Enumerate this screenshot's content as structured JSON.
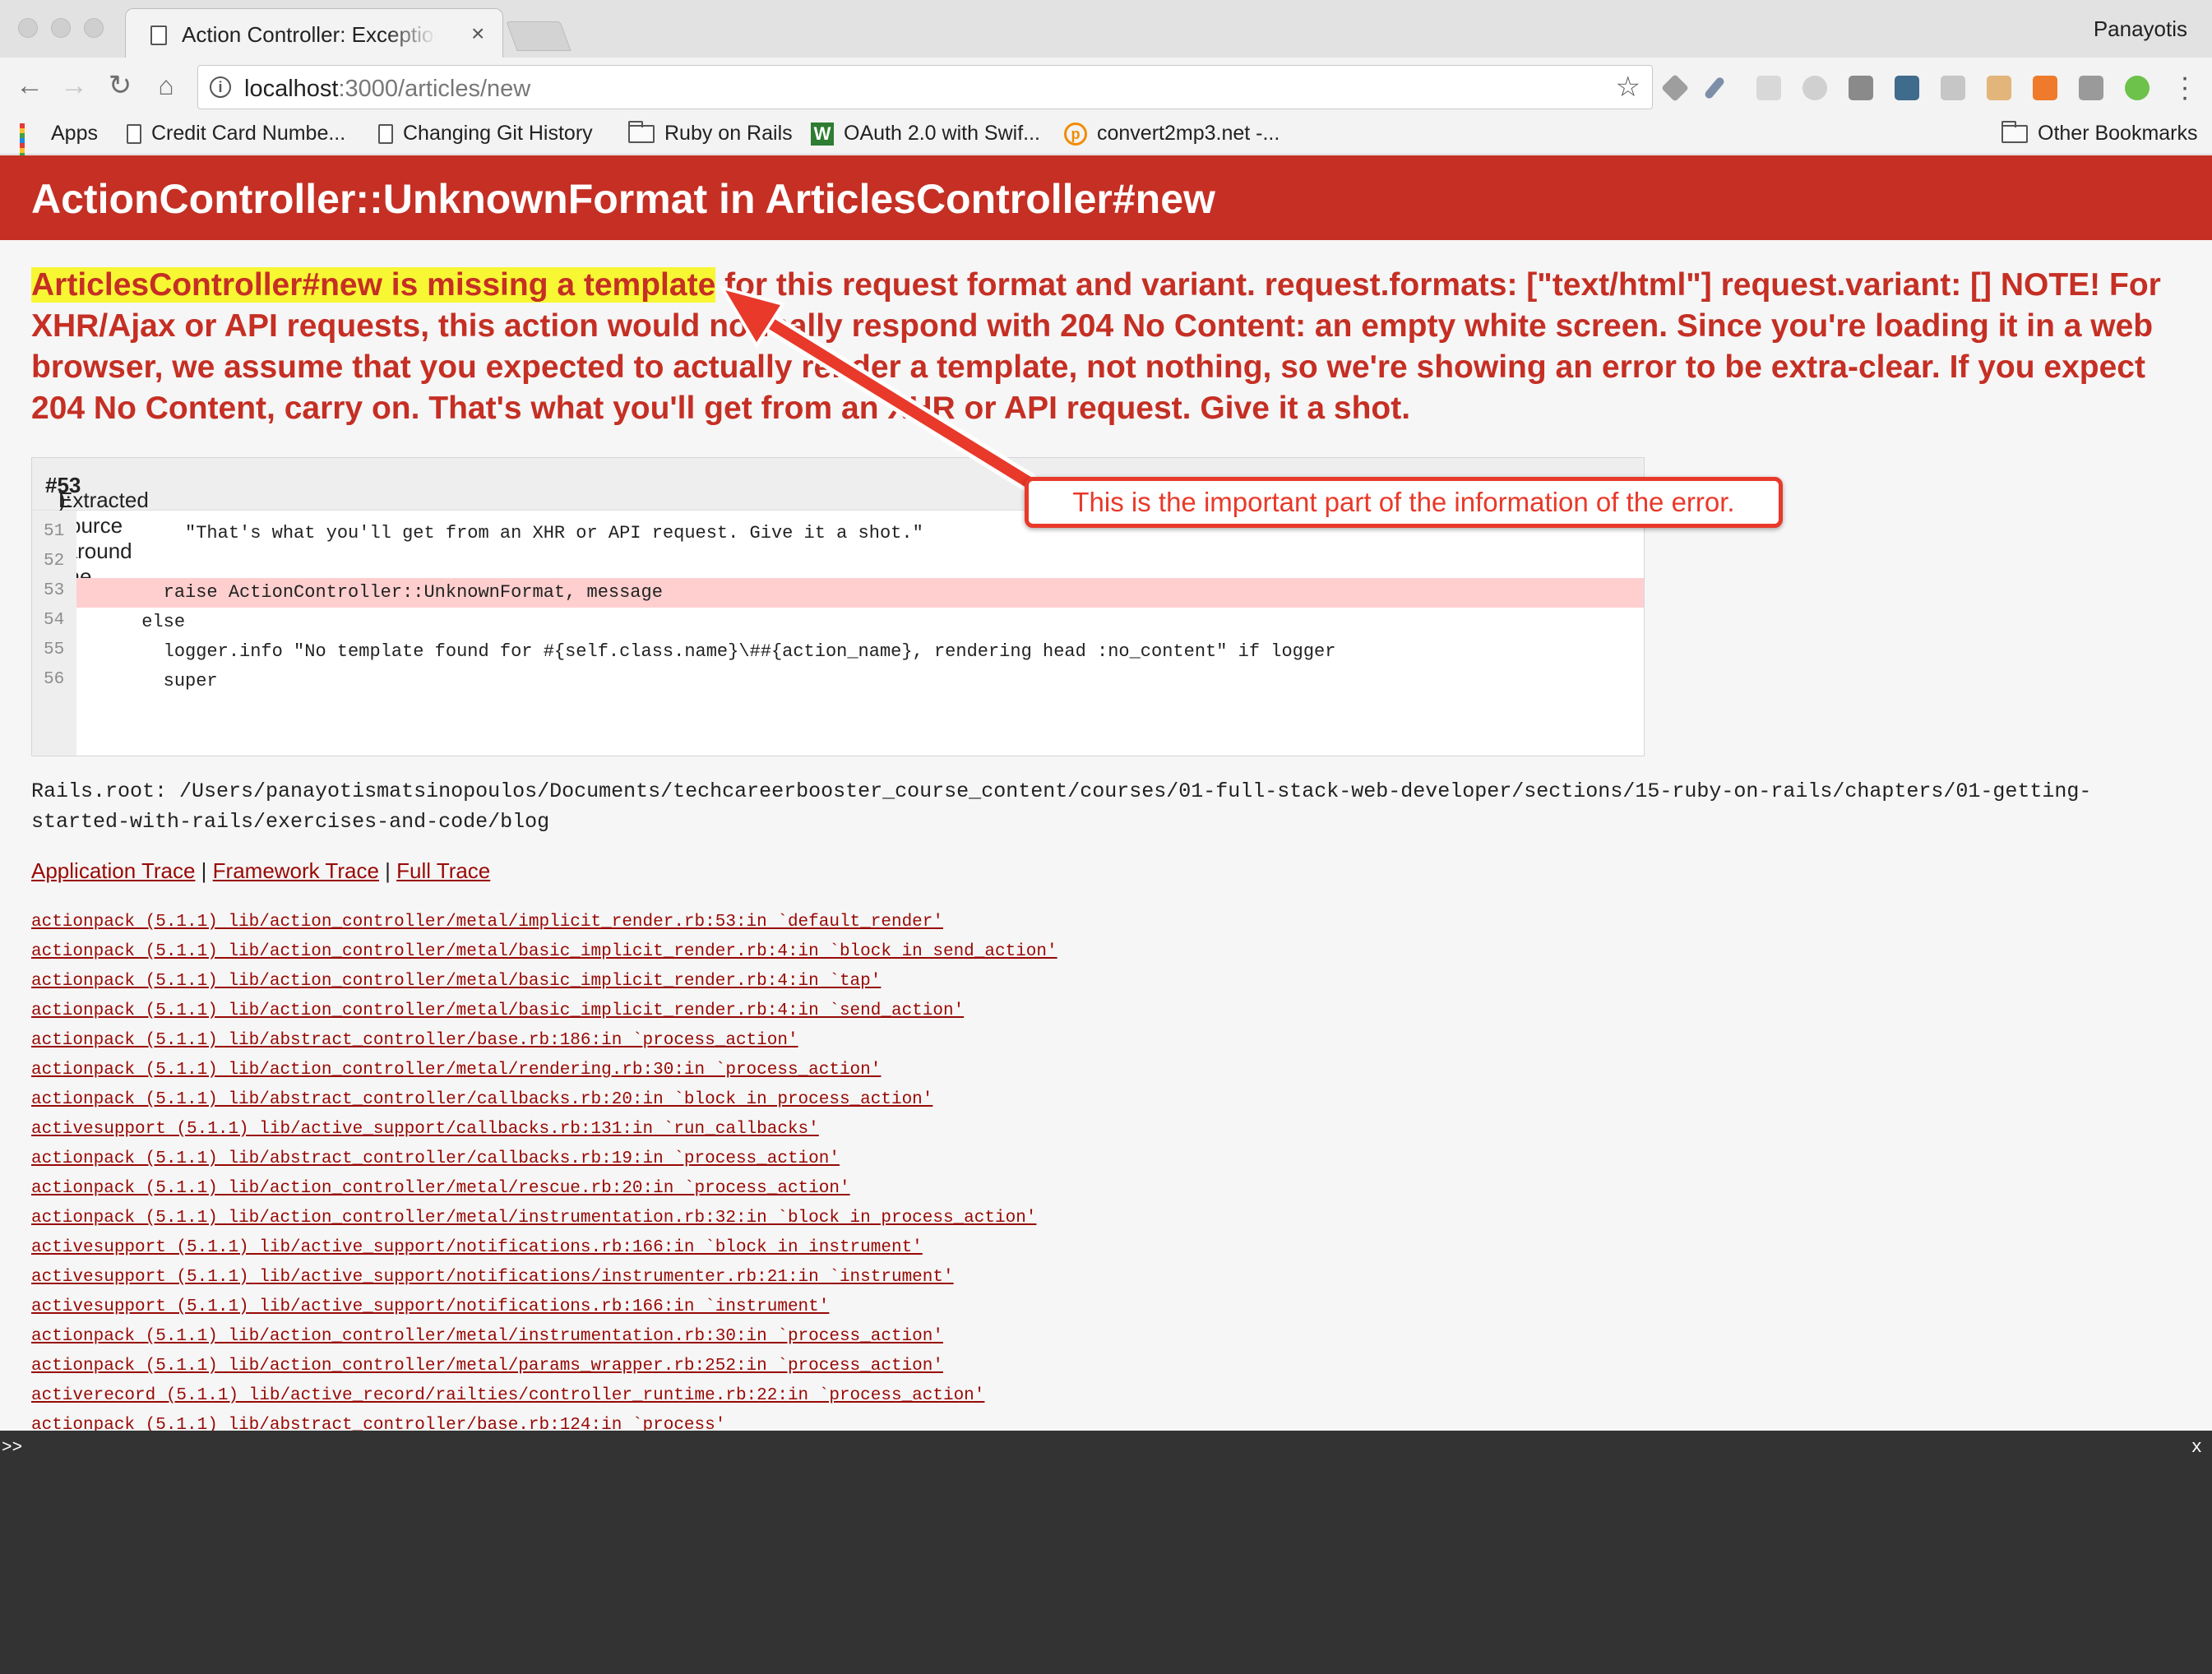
{
  "browser": {
    "tab_title": "Action Controller: Exception caught",
    "tab_close": "×",
    "profile_name": "Panayotis",
    "url_host": "localhost",
    "url_path": ":3000/articles/new",
    "bookmarks": [
      {
        "label": "Apps",
        "icon": "apps-grid-icon"
      },
      {
        "label": "Credit Card Numbe...",
        "icon": "document-icon"
      },
      {
        "label": "Changing Git History",
        "icon": "document-icon"
      },
      {
        "label": "Ruby on Rails",
        "icon": "folder-icon"
      },
      {
        "label": "OAuth 2.0 with Swif...",
        "icon": "w-logo-icon"
      },
      {
        "label": "convert2mp3.net -...",
        "icon": "convert2mp3-icon"
      }
    ],
    "other_bookmarks": "Other Bookmarks"
  },
  "page": {
    "title": "ActionController::UnknownFormat in ArticlesController#new",
    "message_highlight": "ArticlesController#new is missing a template",
    "message_rest": " for this request format and variant. request.formats: [\"text/html\"] request.variant: [] NOTE! For XHR/Ajax or API requests, this action would normally respond with 204 No Content: an empty white screen. Since you're loading it in a web browser, we assume that you expected to actually render a template, not nothing, so we're showing an error to be extra-clear. If you expect 204 No Content, carry on. That's what you'll get from an XHR or API request. Give it a shot.",
    "source_header_prefix": "Extracted source (around line ",
    "source_header_line": "#53",
    "source_header_suffix": "):",
    "source_lines": [
      {
        "no": "51",
        "code": "          \"That's what you'll get from an XHR or API request. Give it a shot.\""
      },
      {
        "no": "52",
        "code": ""
      },
      {
        "no": "53",
        "code": "        raise ActionController::UnknownFormat, message"
      },
      {
        "no": "54",
        "code": "      else"
      },
      {
        "no": "55",
        "code": "        logger.info \"No template found for #{self.class.name}\\##{action_name}, rendering head :no_content\" if logger"
      },
      {
        "no": "56",
        "code": "        super"
      }
    ],
    "rails_root": "Rails.root: /Users/panayotismatsinopoulos/Documents/techcareerbooster_course_content/courses/01-full-stack-web-developer/sections/15-ruby-on-rails/chapters/01-getting-started-with-rails/exercises-and-code/blog",
    "trace_links": {
      "application": "Application Trace",
      "framework": "Framework Trace",
      "full": "Full Trace",
      "separator": " | "
    },
    "trace": [
      "actionpack (5.1.1) lib/action_controller/metal/implicit_render.rb:53:in `default_render'",
      "actionpack (5.1.1) lib/action_controller/metal/basic_implicit_render.rb:4:in `block in send_action'",
      "actionpack (5.1.1) lib/action_controller/metal/basic_implicit_render.rb:4:in `tap'",
      "actionpack (5.1.1) lib/action_controller/metal/basic_implicit_render.rb:4:in `send_action'",
      "actionpack (5.1.1) lib/abstract_controller/base.rb:186:in `process_action'",
      "actionpack (5.1.1) lib/action_controller/metal/rendering.rb:30:in `process_action'",
      "actionpack (5.1.1) lib/abstract_controller/callbacks.rb:20:in `block in process_action'",
      "activesupport (5.1.1) lib/active_support/callbacks.rb:131:in `run_callbacks'",
      "actionpack (5.1.1) lib/abstract_controller/callbacks.rb:19:in `process_action'",
      "actionpack (5.1.1) lib/action_controller/metal/rescue.rb:20:in `process_action'",
      "actionpack (5.1.1) lib/action_controller/metal/instrumentation.rb:32:in `block in process_action'",
      "activesupport (5.1.1) lib/active_support/notifications.rb:166:in `block in instrument'",
      "activesupport (5.1.1) lib/active_support/notifications/instrumenter.rb:21:in `instrument'",
      "activesupport (5.1.1) lib/active_support/notifications.rb:166:in `instrument'",
      "actionpack (5.1.1) lib/action_controller/metal/instrumentation.rb:30:in `process_action'",
      "actionpack (5.1.1) lib/action_controller/metal/params_wrapper.rb:252:in `process_action'",
      "activerecord (5.1.1) lib/active_record/railties/controller_runtime.rb:22:in `process_action'",
      "actionpack (5.1.1) lib/abstract_controller/base.rb:124:in `process'"
    ],
    "annotation": "This is the important part of the information of the error.",
    "accent_color": "#c52f24",
    "annotation_color": "#e8392a"
  },
  "console": {
    "prompt": ">>",
    "close": "x"
  }
}
